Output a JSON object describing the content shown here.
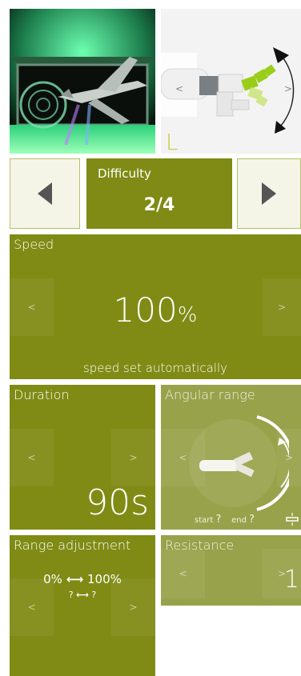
{
  "difficulty": {
    "label": "Difficulty",
    "value": "2/4"
  },
  "speed": {
    "title": "Speed",
    "value": "100",
    "unit": "%",
    "note": "speed set automatically",
    "prev": "<",
    "next": ">"
  },
  "duration": {
    "title": "Duration",
    "value": "90s",
    "prev": "<",
    "next": ">"
  },
  "angular_range": {
    "title": "Angular range",
    "start_label": "start",
    "start_value": "?",
    "end_label": "end",
    "end_value": "?",
    "prev": "<",
    "next": ">"
  },
  "range_adjustment": {
    "title": "Range adjustment",
    "from": "0%",
    "to": "100%",
    "sub_from": "?",
    "sub_to": "?",
    "prev": "<",
    "next": ">"
  },
  "resistance": {
    "title": "Resistance",
    "value": "1",
    "prev": "<",
    "next": ">"
  },
  "hand_image": {
    "side_label": "L",
    "prev": "<",
    "next": ">"
  },
  "colors": {
    "tile": "#7f8b14",
    "tile_dim": "#98a24a",
    "arrow_bg": "#f4f5e6",
    "accent": "#a8c800"
  },
  "icons": [
    "chevron-left-icon",
    "chevron-right-icon",
    "link-icon",
    "rotate-arrow-icon"
  ]
}
